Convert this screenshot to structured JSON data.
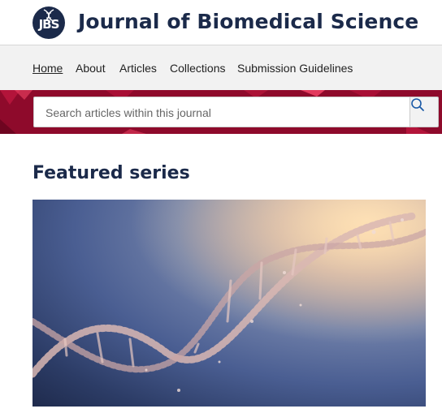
{
  "header": {
    "logo_text": "JBS",
    "journal_title": "Journal of Biomedical Science"
  },
  "nav": {
    "items": [
      {
        "label": "Home",
        "active": true
      },
      {
        "label": "About",
        "active": false
      },
      {
        "label": "Articles",
        "active": false
      },
      {
        "label": "Collections",
        "active": false
      },
      {
        "label": "Submission Guidelines",
        "active": false
      }
    ]
  },
  "search": {
    "placeholder": "Search articles within this journal",
    "icon": "search-icon"
  },
  "featured": {
    "title": "Featured series",
    "image": "dna-double-helix"
  },
  "colors": {
    "brand_navy": "#1b2a4a",
    "band_red": "#8e0a2b",
    "nav_bg": "#f2f2f2"
  }
}
